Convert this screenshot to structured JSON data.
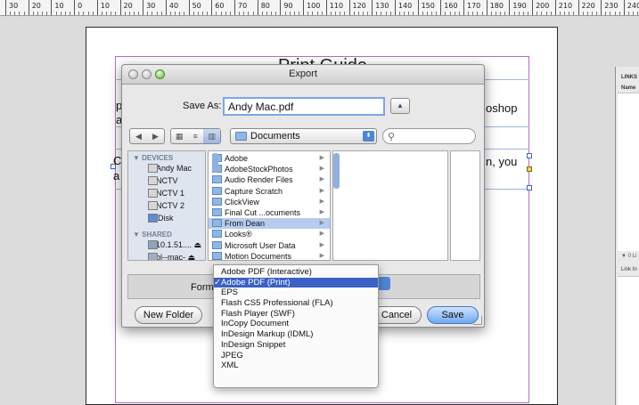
{
  "ruler": {
    "labels": [
      "30",
      "20",
      "10",
      "0",
      "10",
      "20",
      "30",
      "40",
      "50",
      "60",
      "70",
      "80",
      "90",
      "100",
      "110",
      "120",
      "130",
      "140",
      "150",
      "160",
      "170",
      "180",
      "190",
      "200",
      "210",
      "220",
      "230",
      "240"
    ]
  },
  "document": {
    "title": "Print Guide",
    "fragments": {
      "p": "p",
      "a1": "a",
      "oshop": "oshop",
      "c": "C",
      "a2": "a",
      "n_you": "n, you"
    },
    "guide_color": "#b66bc6"
  },
  "links_panel": {
    "tab": "LINKS",
    "column_name": "Name",
    "count": "0 Li",
    "info": "Link In"
  },
  "export_dialog": {
    "title": "Export",
    "save_as_label": "Save As:",
    "save_as_value": "Andy Mac.pdf",
    "location": "Documents",
    "search_placeholder": "",
    "sidebar": {
      "devices_header": "DEVICES",
      "devices": [
        "Andy Mac",
        "NCTV",
        "NCTV 1",
        "NCTV 2",
        "iDisk"
      ],
      "shared_header": "SHARED",
      "shared": [
        "10.1.51....",
        "bl--mac-"
      ]
    },
    "folders": [
      "Adobe",
      "AdobeStockPhotos",
      "Audio Render Files",
      "Capture Scratch",
      "ClickView",
      "Final Cut ...ocuments",
      "From Dean",
      "Looks®",
      "Microsoft User Data",
      "Motion Documents"
    ],
    "selected_folder": "From Dean",
    "format_label": "Forma",
    "new_folder_label": "New Folder",
    "cancel_label": "Cancel",
    "save_label": "Save",
    "accent": "#6fa7f0"
  },
  "format_menu": {
    "items": [
      "Adobe PDF (Interactive)",
      "Adobe PDF (Print)",
      "EPS",
      "Flash CS5 Professional (FLA)",
      "Flash Player (SWF)",
      "InCopy Document",
      "InDesign Markup (IDML)",
      "InDesign Snippet",
      "JPEG",
      "XML"
    ],
    "selected": "Adobe PDF (Print)",
    "check": "✓",
    "highlight": "#3b61c3"
  }
}
